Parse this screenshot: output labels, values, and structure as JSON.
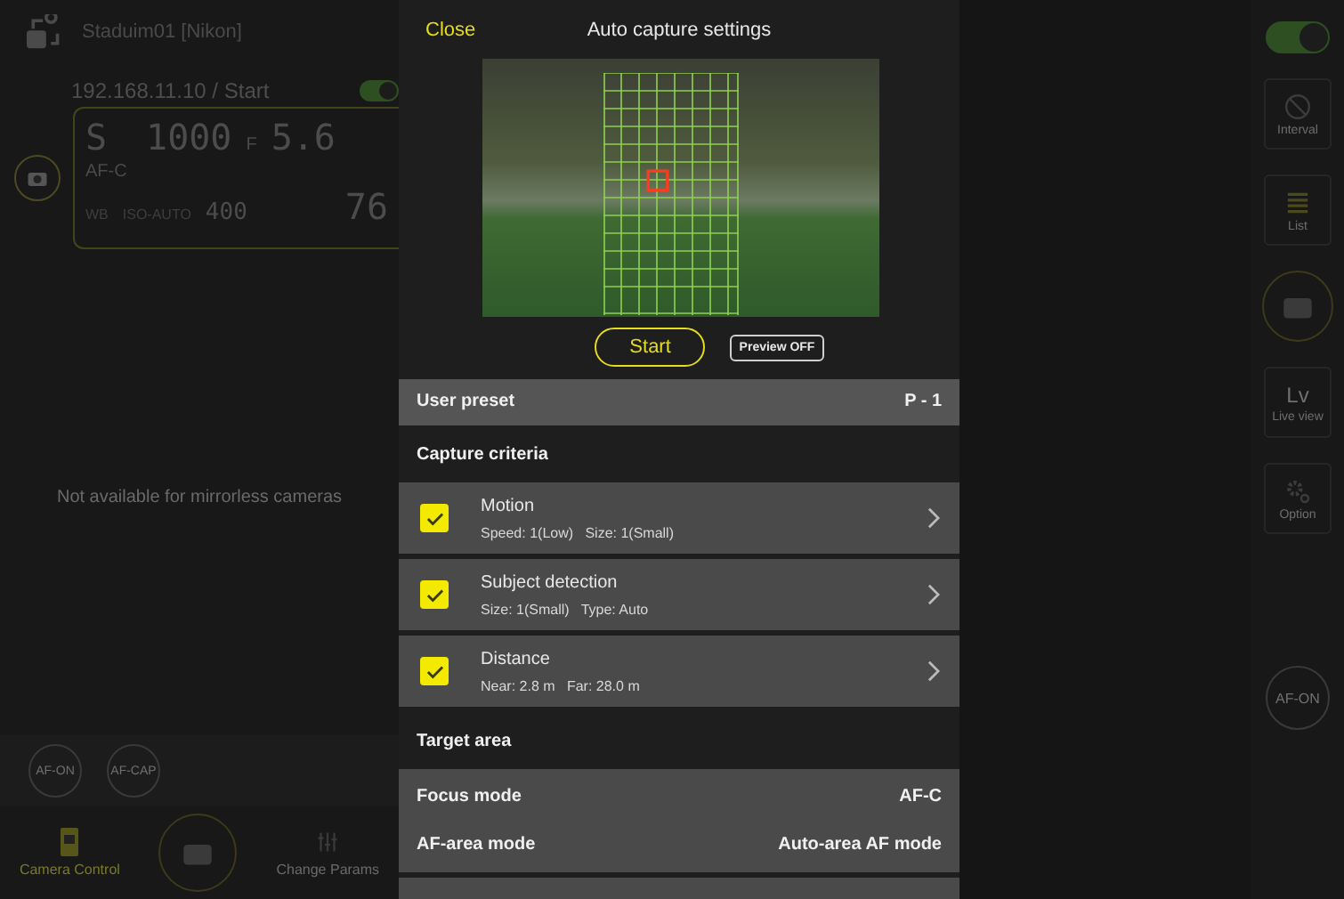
{
  "background_app": {
    "camera_name": "Staduim01 [Nikon]",
    "connection": "192.168.11.10 / Start",
    "connection_toggle": {
      "on": true
    },
    "lcd": {
      "mode": "S",
      "shutter": "1000",
      "aperture_prefix": "F",
      "aperture": "5.6",
      "focus": "AF-C",
      "wb": "WB",
      "iso_label": "ISO-AUTO",
      "iso": "400",
      "remaining": "76"
    },
    "message": "Not available for mirrorless cameras",
    "af_buttons": [
      "AF-ON",
      "AF-CAP"
    ],
    "bottom_tabs": [
      {
        "label": "Camera Control",
        "selected": true
      },
      {
        "label": "Change Params",
        "selected": false
      }
    ],
    "side_toggle": {
      "on": true
    },
    "side_buttons": [
      {
        "kind": "interval",
        "label": "Interval"
      },
      {
        "kind": "list",
        "label": "List"
      },
      {
        "kind": "shutter"
      },
      {
        "kind": "text",
        "label": "Live view",
        "symbol": "Lv"
      },
      {
        "kind": "option",
        "label": "Option"
      },
      {
        "kind": "round",
        "label": "AF-ON"
      }
    ]
  },
  "dialog": {
    "close": "Close",
    "title": "Auto capture settings",
    "start": "Start",
    "preview": "Preview OFF",
    "user_preset": {
      "label": "User preset",
      "value": "P - 1"
    },
    "criteria_heading": "Capture criteria",
    "criteria": [
      {
        "title": "Motion",
        "details": "Speed: 1(Low)   Size: 1(Small)",
        "checked": true
      },
      {
        "title": "Subject detection",
        "details": "Size: 1(Small)   Type: Auto",
        "checked": true
      },
      {
        "title": "Distance",
        "details": "Near: 2.8 m   Far: 28.0 m",
        "checked": true
      }
    ],
    "target_heading": "Target area",
    "target_rows": [
      {
        "label": "Focus mode",
        "value": "AF-C"
      },
      {
        "label": "AF-area mode",
        "value": "Auto-area AF mode"
      }
    ]
  }
}
